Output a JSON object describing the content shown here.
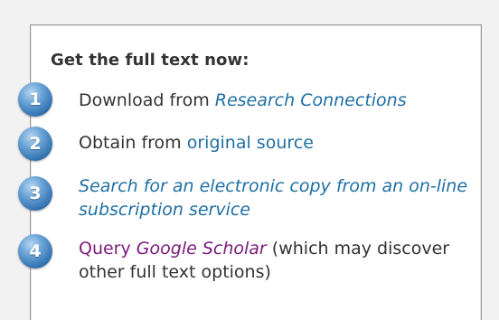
{
  "panel": {
    "heading": "Get the full text now:",
    "steps": [
      {
        "number": "1",
        "prefix": "Download from ",
        "link": "Research Connections"
      },
      {
        "number": "2",
        "prefix": "Obtain from ",
        "link": "original source"
      },
      {
        "number": "3",
        "link": "Search for an electronic copy from an on-line subscription service"
      },
      {
        "number": "4",
        "link": "Query ",
        "link_italic": "Google Scholar",
        "suffix": " (which may discover other full text options)"
      }
    ]
  },
  "colors": {
    "link": "#1f6fa3",
    "visited_link": "#7a1b7a",
    "badge": "#2e6fae"
  }
}
